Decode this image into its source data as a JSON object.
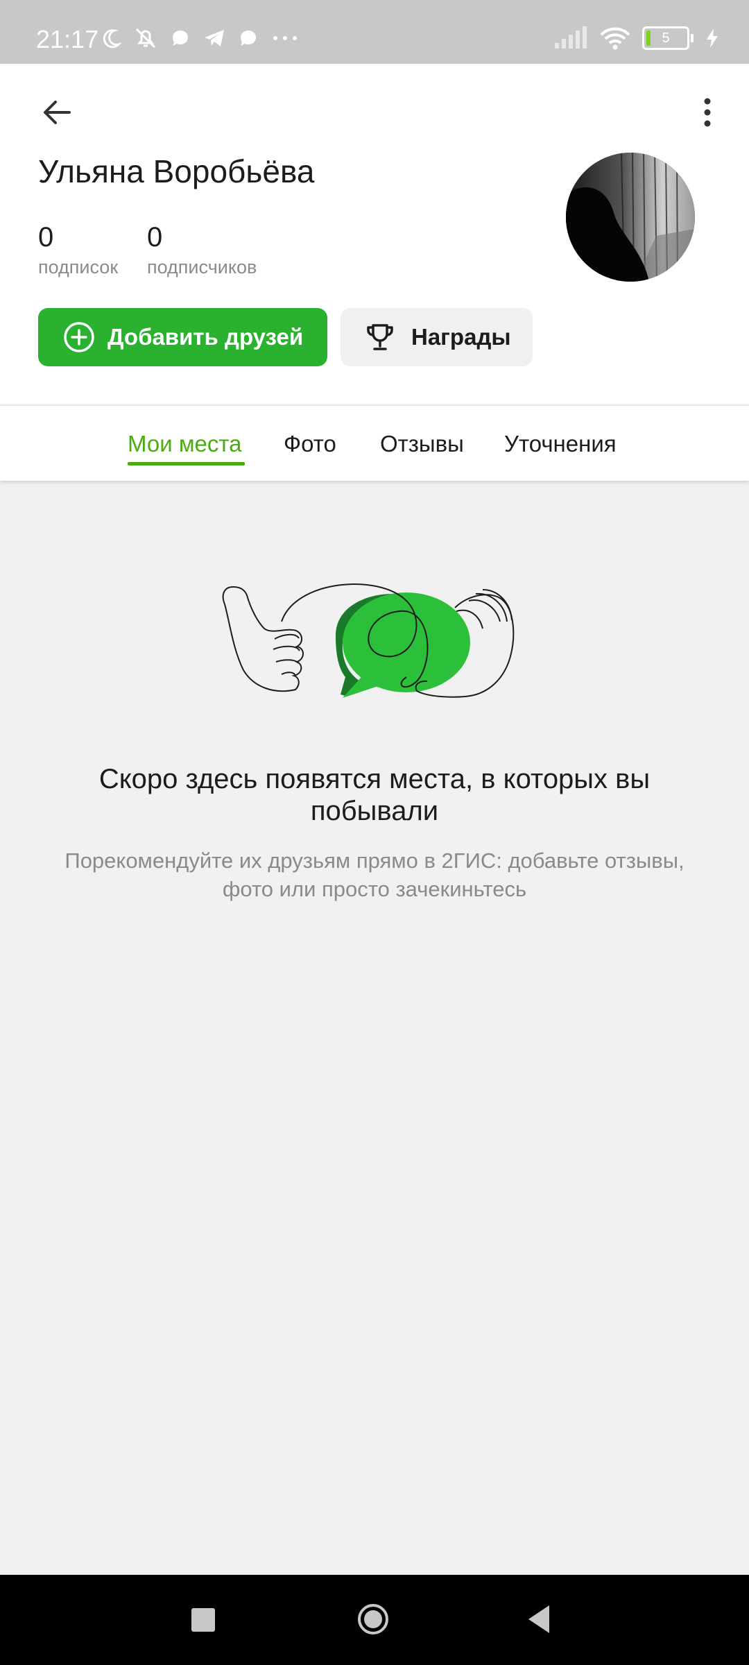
{
  "status_bar": {
    "time": "21:17",
    "battery_level": "5",
    "icons": [
      "moon-icon",
      "bell-off-icon",
      "chat-bubble-icon",
      "telegram-icon",
      "chat-bubble-icon",
      "more-dots-icon",
      "signal-icon",
      "wifi-icon",
      "battery-icon",
      "charging-icon"
    ]
  },
  "profile": {
    "name": "Ульяна Воробьёва",
    "following_count": "0",
    "following_label": "подписок",
    "followers_count": "0",
    "followers_label": "подписчиков"
  },
  "actions": {
    "add_friends_label": "Добавить друзей",
    "awards_label": "Награды"
  },
  "tabs": [
    {
      "label": "Мои места",
      "active": true
    },
    {
      "label": "Фото",
      "active": false
    },
    {
      "label": "Отзывы",
      "active": false
    },
    {
      "label": "Уточнения",
      "active": false
    }
  ],
  "empty_state": {
    "title": "Скоро здесь появятся места, в которых вы побывали",
    "subtitle": "Порекомендуйте их друзьям прямо в 2ГИС: добавьте отзывы, фото или просто зачекиньтесь"
  },
  "colors": {
    "accent_green": "#29b12f",
    "tab_active": "#4caa12",
    "background": "#f1f1f1"
  }
}
